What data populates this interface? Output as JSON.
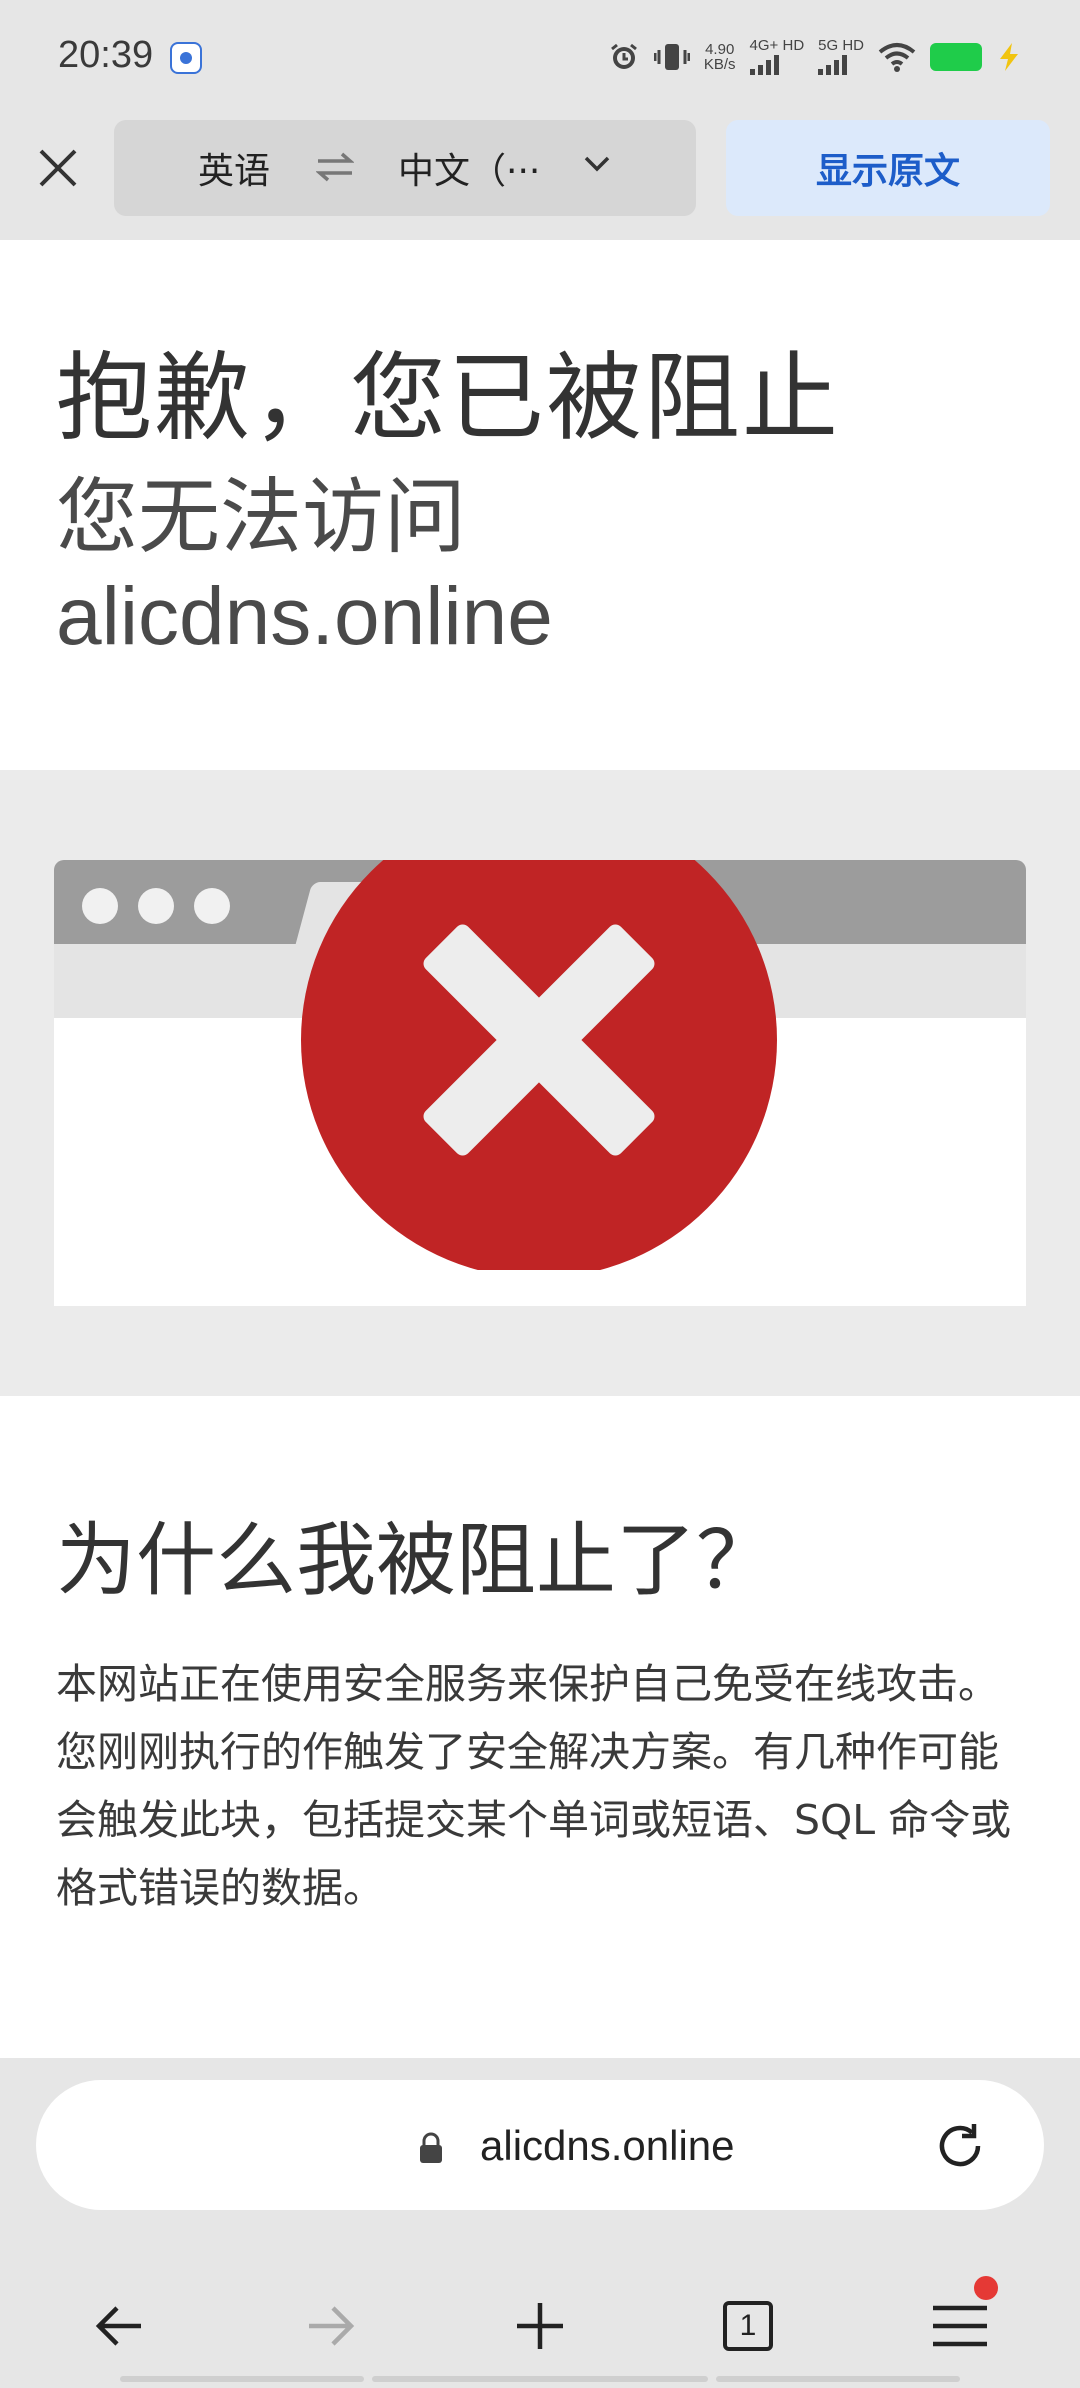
{
  "status_bar": {
    "time": "20:39",
    "net_speed_value": "4.90",
    "net_speed_unit": "KB/s",
    "sim1": "4G+ HD",
    "sim2": "5G HD"
  },
  "translate_bar": {
    "source_lang": "英语",
    "target_lang": "中文（···",
    "show_original_label": "显示原文"
  },
  "page": {
    "title": "抱歉，您已被阻止",
    "subtitle_line1": "您无法访问",
    "subtitle_line2": "alicdns.online",
    "why_title": "为什么我被阻止了？",
    "why_body": "本网站正在使用安全服务来保护自己免受在线攻击。您刚刚执行的作触发了安全解决方案。有几种作可能会触发此块，包括提交某个单词或短语、SQL 命令或格式错误的数据。"
  },
  "address_bar": {
    "url": "alicdns.online"
  },
  "nav": {
    "tab_count": "1"
  },
  "colors": {
    "accent": "#1d5dc9",
    "error_red": "#c02425",
    "battery": "#1fcc4a"
  }
}
